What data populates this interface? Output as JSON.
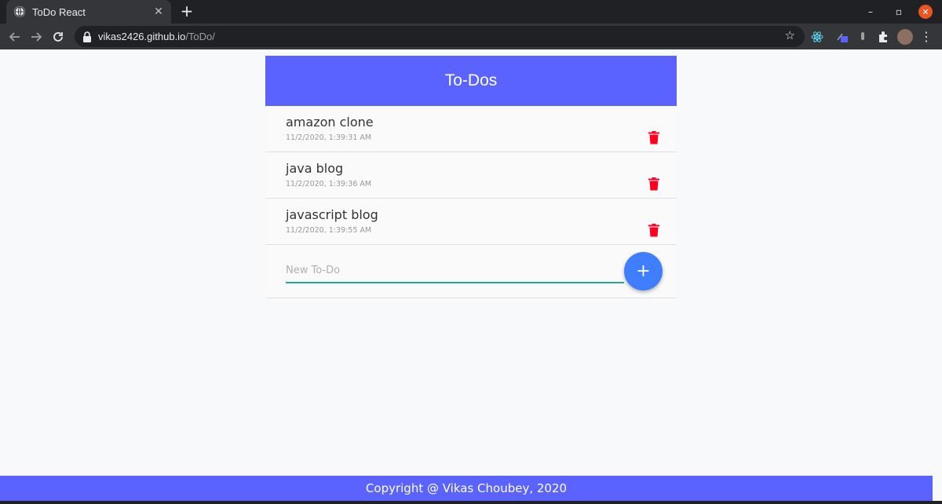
{
  "browser": {
    "tab_title": "ToDo React",
    "tab_close": "✕",
    "new_tab": "+",
    "url_host": "vikas2426.github.io",
    "url_path": "/ToDo/",
    "window_controls": {
      "minimize": "–",
      "maximize": "▫",
      "close": "✕"
    }
  },
  "app": {
    "title": "To-Dos",
    "todos": [
      {
        "text": "amazon clone",
        "time": "11/2/2020, 1:39:31 AM"
      },
      {
        "text": "java blog",
        "time": "11/2/2020, 1:39:36 AM"
      },
      {
        "text": "javascript blog",
        "time": "11/2/2020, 1:39:55 AM"
      }
    ],
    "new_todo_placeholder": "New To-Do",
    "add_button_label": "+",
    "accent_color": "#5a63ff",
    "delete_color": "#ff0020",
    "input_underline_color": "#26a69a",
    "add_button_color": "#3f7fff"
  },
  "footer": {
    "text": "Copyright @ Vikas Choubey, 2020"
  }
}
